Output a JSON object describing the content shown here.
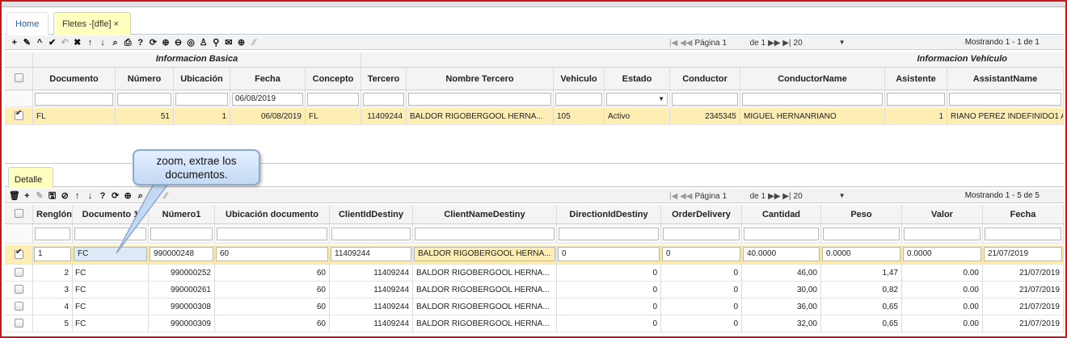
{
  "tabs": {
    "home": "Home",
    "active": "Fletes -[dfle]",
    "close": "×"
  },
  "toolbar1": {
    "icons": [
      {
        "name": "add-icon",
        "glyph": "+",
        "enabled": true
      },
      {
        "name": "edit-icon",
        "glyph": "✎",
        "enabled": true
      },
      {
        "name": "chevron-up-icon",
        "glyph": "^",
        "enabled": true
      },
      {
        "name": "check-icon",
        "glyph": "✔",
        "enabled": true
      },
      {
        "name": "undo-icon",
        "glyph": "↶",
        "enabled": false
      },
      {
        "name": "delete-icon",
        "glyph": "✖",
        "enabled": true
      },
      {
        "name": "arrow-up-icon",
        "glyph": "↑",
        "enabled": true
      },
      {
        "name": "arrow-down-icon",
        "glyph": "↓",
        "enabled": true
      },
      {
        "name": "search-icon",
        "glyph": "⌕",
        "enabled": true
      },
      {
        "name": "print-icon",
        "glyph": "⎙",
        "enabled": true
      },
      {
        "name": "help-icon",
        "glyph": "?",
        "enabled": true
      },
      {
        "name": "refresh-icon",
        "glyph": "⟳",
        "enabled": true
      },
      {
        "name": "zoom-in-icon",
        "glyph": "⊕",
        "enabled": true
      },
      {
        "name": "zoom-out-icon",
        "glyph": "⊖",
        "enabled": true
      },
      {
        "name": "comment-icon",
        "glyph": "◎",
        "enabled": true
      },
      {
        "name": "user-icon",
        "glyph": "♙",
        "enabled": true
      },
      {
        "name": "pin-icon",
        "glyph": "⚲",
        "enabled": true
      },
      {
        "name": "mail-icon",
        "glyph": "✉",
        "enabled": true
      },
      {
        "name": "plus-circle-icon",
        "glyph": "⊕",
        "enabled": true
      },
      {
        "name": "resize-icon",
        "glyph": "⁄⁄",
        "enabled": false
      }
    ],
    "pager": {
      "first_prev": "|◀ ◀◀",
      "page_label": "Página",
      "page_value": "1",
      "of_label": "de 1",
      "next_last": "▶▶ ▶|",
      "size": "20"
    },
    "showing": "Mostrando 1 - 1 de 1"
  },
  "master": {
    "groups": [
      "Informacion Basica",
      "Informacion Vehículo"
    ],
    "columns": [
      "Documento",
      "Número",
      "Ubicación",
      "Fecha",
      "Concepto",
      "Tercero",
      "Nombre Tercero",
      "Vehiculo",
      "Estado",
      "Conductor",
      "ConductorName",
      "Asistente",
      "AssistantName"
    ],
    "filters": [
      "",
      "",
      "",
      "06/08/2019",
      "",
      "",
      "",
      "",
      "",
      "",
      "",
      "",
      ""
    ],
    "rows": [
      {
        "documento": "FL",
        "numero": "51",
        "ubicacion": "1",
        "fecha": "06/08/2019",
        "concepto": "FL",
        "tercero": "11409244",
        "nombre_tercero": "BALDOR RIGOBERGOOL HERNA...",
        "vehiculo": "105",
        "estado": "Activo",
        "conductor": "2345345",
        "conductor_name": "MIGUEL HERNANRIANO",
        "asistente": "1",
        "assistant_name": "RIANO PEREZ INDEFINIDO1 A"
      }
    ]
  },
  "detail_tab": "Detalle",
  "callout": {
    "line1": "zoom, extrae los",
    "line2": "documentos."
  },
  "toolbar2": {
    "icons": [
      {
        "name": "trash-icon",
        "glyph": "🗑",
        "enabled": true
      },
      {
        "name": "add-icon",
        "glyph": "+",
        "enabled": true
      },
      {
        "name": "edit-icon",
        "glyph": "✎",
        "enabled": false
      },
      {
        "name": "save-icon",
        "glyph": "🖫",
        "enabled": true
      },
      {
        "name": "cancel-icon",
        "glyph": "⊘",
        "enabled": true
      },
      {
        "name": "arrow-up-icon",
        "glyph": "↑",
        "enabled": true
      },
      {
        "name": "arrow-down-icon",
        "glyph": "↓",
        "enabled": true
      },
      {
        "name": "help-icon",
        "glyph": "?",
        "enabled": true
      },
      {
        "name": "refresh-icon",
        "glyph": "⟳",
        "enabled": true
      },
      {
        "name": "zoom-in-icon",
        "glyph": "⊕",
        "enabled": true
      },
      {
        "name": "search-icon",
        "glyph": "⌕",
        "enabled": true
      },
      {
        "name": "plus-circle-icon",
        "glyph": "⊕",
        "enabled": true
      },
      {
        "name": "resize-icon",
        "glyph": "⁄⁄",
        "enabled": false
      }
    ],
    "pager": {
      "first_prev": "|◀ ◀◀",
      "page_label": "Página",
      "page_value": "1",
      "of_label": "de 1",
      "next_last": "▶▶ ▶|",
      "size": "20"
    },
    "showing": "Mostrando 1 - 5 de 5"
  },
  "detail": {
    "columns": [
      "Renglón",
      "Documento 1",
      "Número1",
      "Ubicación documento",
      "ClientIdDestiny",
      "ClientNameDestiny",
      "DirectionIdDestiny",
      "OrderDelivery",
      "Cantidad",
      "Peso",
      "Valor",
      "Fecha"
    ],
    "edit_row": {
      "renglon": "1",
      "documento": "FC",
      "numero": "990000248",
      "ubicacion": "60",
      "client_id": "11409244",
      "client_name": "BALDOR RIGOBERGOOL HERNA...",
      "direction": "0",
      "order": "0",
      "cantidad": "40.0000",
      "peso": "0.0000",
      "valor": "0.0000",
      "fecha": "21/07/2019"
    },
    "rows": [
      {
        "renglon": "2",
        "documento": "FC",
        "numero": "990000252",
        "ubicacion": "60",
        "client_id": "11409244",
        "client_name": "BALDOR RIGOBERGOOL HERNA...",
        "direction": "0",
        "order": "0",
        "cantidad": "46,00",
        "peso": "1,47",
        "valor": "0.00",
        "fecha": "21/07/2019"
      },
      {
        "renglon": "3",
        "documento": "FC",
        "numero": "990000261",
        "ubicacion": "60",
        "client_id": "11409244",
        "client_name": "BALDOR RIGOBERGOOL HERNA...",
        "direction": "0",
        "order": "0",
        "cantidad": "30,00",
        "peso": "0,82",
        "valor": "0.00",
        "fecha": "21/07/2019"
      },
      {
        "renglon": "4",
        "documento": "FC",
        "numero": "990000308",
        "ubicacion": "60",
        "client_id": "11409244",
        "client_name": "BALDOR RIGOBERGOOL HERNA...",
        "direction": "0",
        "order": "0",
        "cantidad": "36,00",
        "peso": "0,65",
        "valor": "0.00",
        "fecha": "21/07/2019"
      },
      {
        "renglon": "5",
        "documento": "FC",
        "numero": "990000309",
        "ubicacion": "60",
        "client_id": "11409244",
        "client_name": "BALDOR RIGOBERGOOL HERNA...",
        "direction": "0",
        "order": "0",
        "cantidad": "32,00",
        "peso": "0,65",
        "valor": "0.00",
        "fecha": "21/07/2019"
      }
    ]
  }
}
